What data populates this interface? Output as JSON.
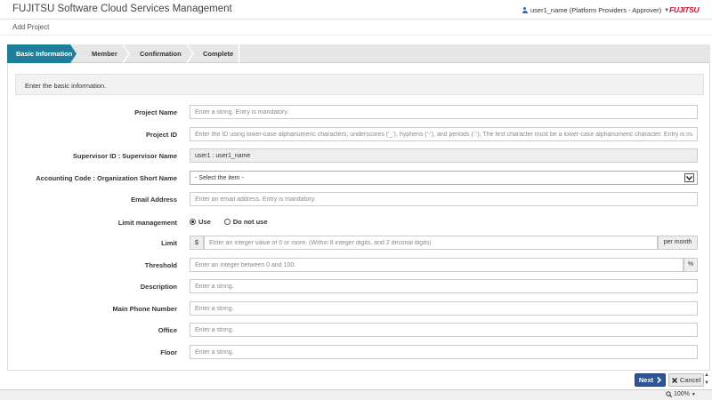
{
  "header": {
    "app_title": "FUJITSU Software Cloud Services Management",
    "user": "user1_name (Platform Providers - Approver)",
    "logo": "FUJITSU"
  },
  "page": {
    "title": "Add Project"
  },
  "steps": [
    {
      "label": "Basic Information",
      "active": true
    },
    {
      "label": "Member",
      "active": false
    },
    {
      "label": "Confirmation",
      "active": false
    },
    {
      "label": "Complete",
      "active": false
    }
  ],
  "info": {
    "text": "Enter the basic information."
  },
  "form": {
    "project_name": {
      "label": "Project Name",
      "placeholder": "Enter a string. Entry is mandatory."
    },
    "project_id": {
      "label": "Project ID",
      "placeholder": "Enter the ID using lower-case alphanumeric characters, underscores ('_'), hyphens ('-'), and periods ('.'). The first character must be a lower-case alphanumeric character. Entry is mandatory."
    },
    "supervisor": {
      "label": "Supervisor ID : Supervisor Name",
      "value": "user1 : user1_name"
    },
    "accounting": {
      "label": "Accounting Code : Organization Short Name",
      "value": "- Select the item -"
    },
    "email": {
      "label": "Email Address",
      "placeholder": "Enter an email address. Entry is mandatory."
    },
    "limit_management": {
      "label": "Limit management",
      "options": [
        "Use",
        "Do not use"
      ],
      "selected": "Use"
    },
    "limit": {
      "label": "Limit",
      "prefix": "$",
      "placeholder": "Enter an integer value of 0 or more. (Within 8 integer digits, and 2 decimal digits)",
      "suffix": "per month"
    },
    "threshold": {
      "label": "Threshold",
      "placeholder": "Enter an integer between 0 and 100.",
      "suffix": "%"
    },
    "description": {
      "label": "Description",
      "placeholder": "Enter a string."
    },
    "phone": {
      "label": "Main Phone Number",
      "placeholder": "Enter a string."
    },
    "office": {
      "label": "Office",
      "placeholder": "Enter a string."
    },
    "floor": {
      "label": "Floor",
      "placeholder": "Enter a string."
    }
  },
  "footer": {
    "next_label": "Next",
    "cancel_label": "Cancel"
  },
  "status": {
    "zoom": "100%"
  },
  "colors": {
    "accent": "#1f7f9a",
    "primary_button": "#2f5597",
    "logo": "#c8102e"
  }
}
